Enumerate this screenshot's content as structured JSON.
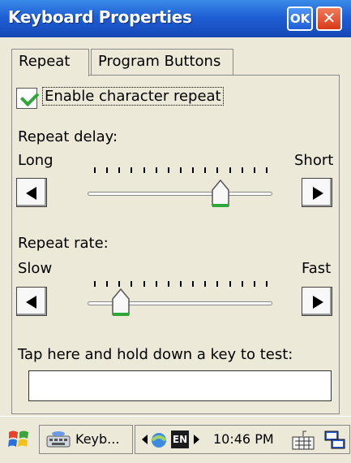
{
  "window": {
    "title": "Keyboard Properties",
    "ok_label": "OK",
    "close_label": "✕"
  },
  "tabs": [
    {
      "label": "Repeat",
      "active": true
    },
    {
      "label": "Program Buttons",
      "active": false
    }
  ],
  "repeat": {
    "enable_label": "Enable character repeat",
    "enable_checked": true,
    "delay": {
      "label": "Repeat delay:",
      "min_label": "Long",
      "max_label": "Short",
      "tick_count": 15,
      "value": 0.72
    },
    "rate": {
      "label": "Repeat rate:",
      "min_label": "Slow",
      "max_label": "Fast",
      "tick_count": 15,
      "value": 0.18
    },
    "test_label": "Tap here and hold down a key to test:",
    "test_value": ""
  },
  "taskbar": {
    "app_label": "Keyb...",
    "language": "EN",
    "time": "10:46 PM"
  },
  "colors": {
    "title_bar": "#1f5fd6",
    "check": "#2fa63a",
    "thumb_accent": "#2fa63a"
  }
}
